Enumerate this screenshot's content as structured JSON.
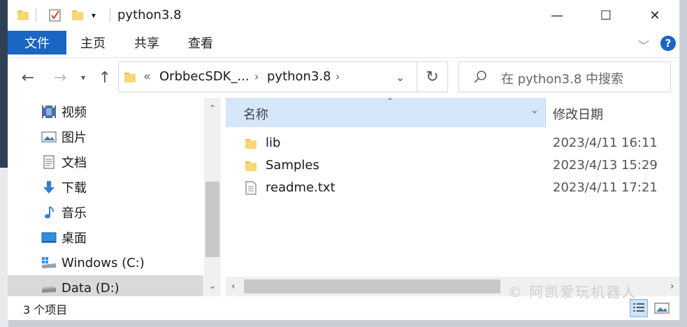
{
  "window": {
    "title": "python3.8",
    "minimize": "—",
    "maximize": "☐",
    "close": "✕"
  },
  "ribbon": {
    "file": "文件",
    "home": "主页",
    "share": "共享",
    "view": "查看",
    "help": "?"
  },
  "address": {
    "overflow": "«",
    "crumbs": [
      "OrbbecSDK_...",
      "python3.8"
    ],
    "search_placeholder": "在 python3.8 中搜索"
  },
  "nav": {
    "items": [
      {
        "label": "视频",
        "icon": "video-icon"
      },
      {
        "label": "图片",
        "icon": "pictures-icon"
      },
      {
        "label": "文档",
        "icon": "documents-icon"
      },
      {
        "label": "下载",
        "icon": "downloads-icon"
      },
      {
        "label": "音乐",
        "icon": "music-icon"
      },
      {
        "label": "桌面",
        "icon": "desktop-icon"
      },
      {
        "label": "Windows (C:)",
        "icon": "drive-c-icon"
      },
      {
        "label": "Data (D:)",
        "icon": "drive-d-icon"
      }
    ]
  },
  "columns": {
    "name": "名称",
    "modified": "修改日期"
  },
  "files": [
    {
      "name": "lib",
      "date": "2023/4/11 16:11",
      "type": "folder"
    },
    {
      "name": "Samples",
      "date": "2023/4/13 15:29",
      "type": "folder"
    },
    {
      "name": "readme.txt",
      "date": "2023/4/11 17:21",
      "type": "text"
    }
  ],
  "status": {
    "count": "3 个项目"
  },
  "watermark": "© 阿凯爱玩机器人",
  "colors": {
    "accent": "#1a66c2",
    "header_bg": "#d5e7f8",
    "selected_bg": "#d9d9d9"
  }
}
